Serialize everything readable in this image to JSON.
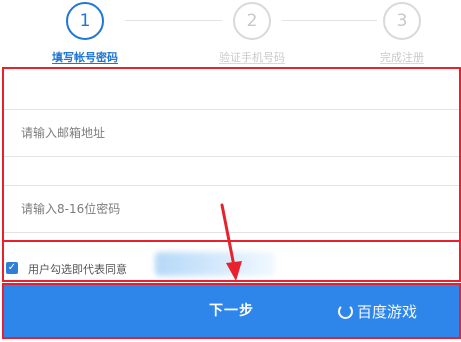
{
  "steps": [
    {
      "number": "1",
      "label": "填写帐号密码"
    },
    {
      "number": "2",
      "label": "验证手机号码"
    },
    {
      "number": "3",
      "label": "完成注册"
    }
  ],
  "email": {
    "placeholder": "请输入邮箱地址",
    "value": ""
  },
  "password": {
    "placeholder": "请输入8-16位密码",
    "value": ""
  },
  "agreement": {
    "checked": true,
    "text": "用户勾选即代表同意"
  },
  "next_button": {
    "label": "下一步"
  },
  "watermark": {
    "text": "百度游戏"
  },
  "colors": {
    "accent": "#2f86ea",
    "highlight": "#e7222e",
    "active_step": "#1f76d6"
  }
}
